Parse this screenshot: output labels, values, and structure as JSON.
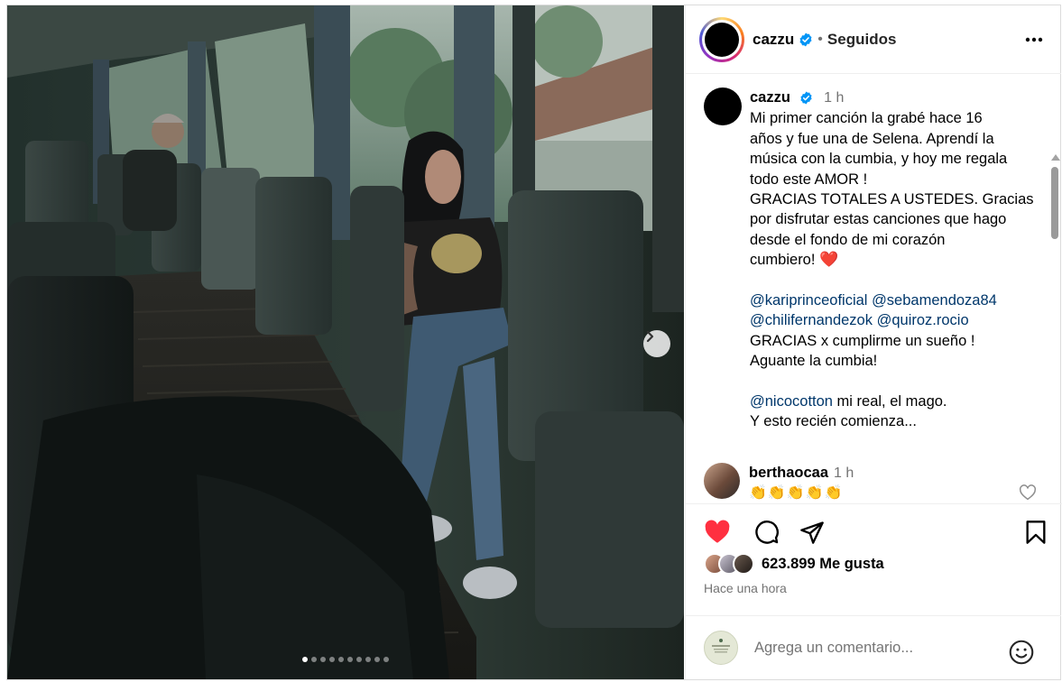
{
  "post": {
    "username": "cazzu",
    "follow_status": "Seguidos",
    "separator": "•",
    "more_label": "•••"
  },
  "caption": {
    "username": "cazzu",
    "time": "1 h",
    "lines": [
      "Mi primer canción la grabé hace 16",
      "años y fue una de Selena. Aprendí la",
      "música con la cumbia, y hoy me regala",
      "todo este AMOR !",
      "GRACIAS TOTALES A USTEDES. Gracias",
      "por disfrutar estas canciones que hago",
      "desde el fondo de mi corazón",
      "cumbiero!"
    ],
    "heart": "❤️",
    "mention_1": "@kariprinceoficial",
    "mention_2": "@sebamendoza84",
    "mention_3": "@chilifernandezok",
    "mention_4": "@quiroz.rocio",
    "line_thanks": "GRACIAS x cumplirme un sueño !",
    "line_cumbia": "Aguante la cumbia!",
    "mention_5": "@nicocotton",
    "line_mago": " mi real, el mago.",
    "line_end": "Y esto recién comienza..."
  },
  "comment": {
    "username": "berthaocaa",
    "time": "1 h",
    "text": "👏👏👏👏👏"
  },
  "likes": {
    "count_text": "623.899 Me gusta",
    "liked": true
  },
  "timestamp": "Hace una hora",
  "composer": {
    "placeholder": "Agrega un comentario..."
  },
  "carousel": {
    "total": 10,
    "active_index": 0
  },
  "colors": {
    "like_red": "#ff3040",
    "verified_blue": "#0095f6",
    "mention_blue": "#00376b",
    "muted_gray": "#737373"
  },
  "icons": [
    "verified-badge-icon",
    "more-options-icon",
    "chevron-right-icon",
    "heart-icon",
    "comment-icon",
    "share-icon",
    "save-icon",
    "emoji-icon"
  ]
}
